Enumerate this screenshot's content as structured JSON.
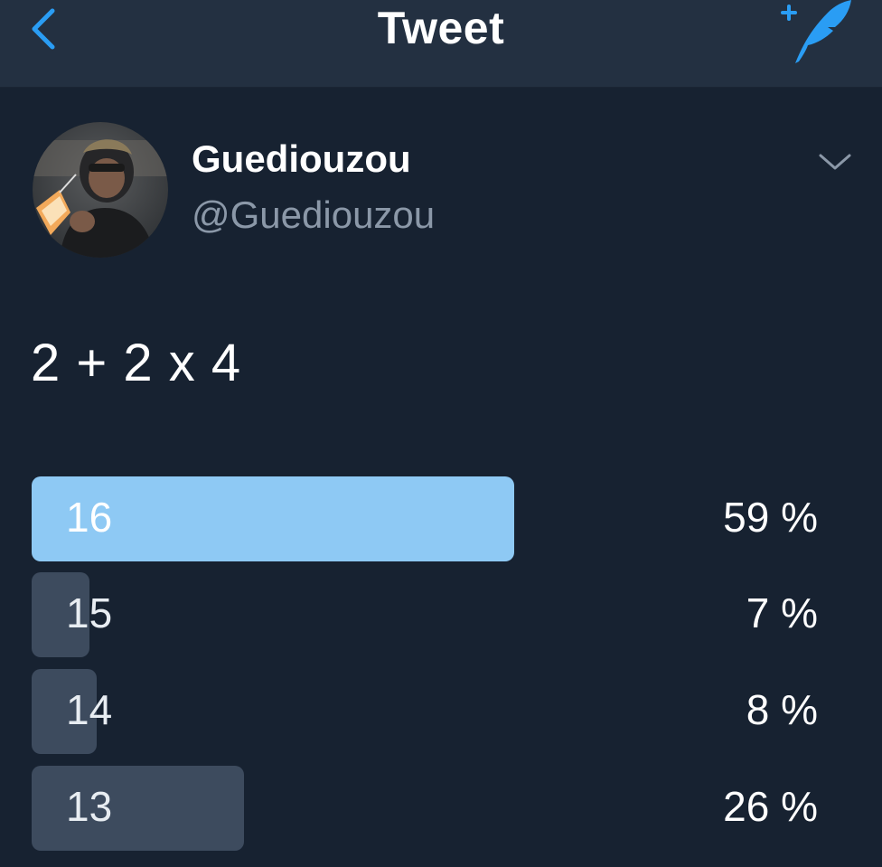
{
  "navbar": {
    "title": "Tweet",
    "back_icon": "chevron-left-icon",
    "compose_icon": "compose-quill-icon"
  },
  "tweet": {
    "display_name": "Guediouzou",
    "handle": "@Guediouzou",
    "text": "2 + 2 x 4",
    "menu_icon": "chevron-down-icon"
  },
  "poll": {
    "options": [
      {
        "label": "16",
        "percent_text": "59 %",
        "percent": 59,
        "winner": true
      },
      {
        "label": "15",
        "percent_text": "7 %",
        "percent": 7,
        "winner": false
      },
      {
        "label": "14",
        "percent_text": "8 %",
        "percent": 8,
        "winner": false
      },
      {
        "label": "13",
        "percent_text": "26 %",
        "percent": 26,
        "winner": false
      }
    ]
  },
  "colors": {
    "accent": "#1da1f2",
    "winner_bar": "#8ec9f4",
    "other_bar": "#3d4b5e",
    "background": "#172231",
    "navbar": "#233041"
  }
}
